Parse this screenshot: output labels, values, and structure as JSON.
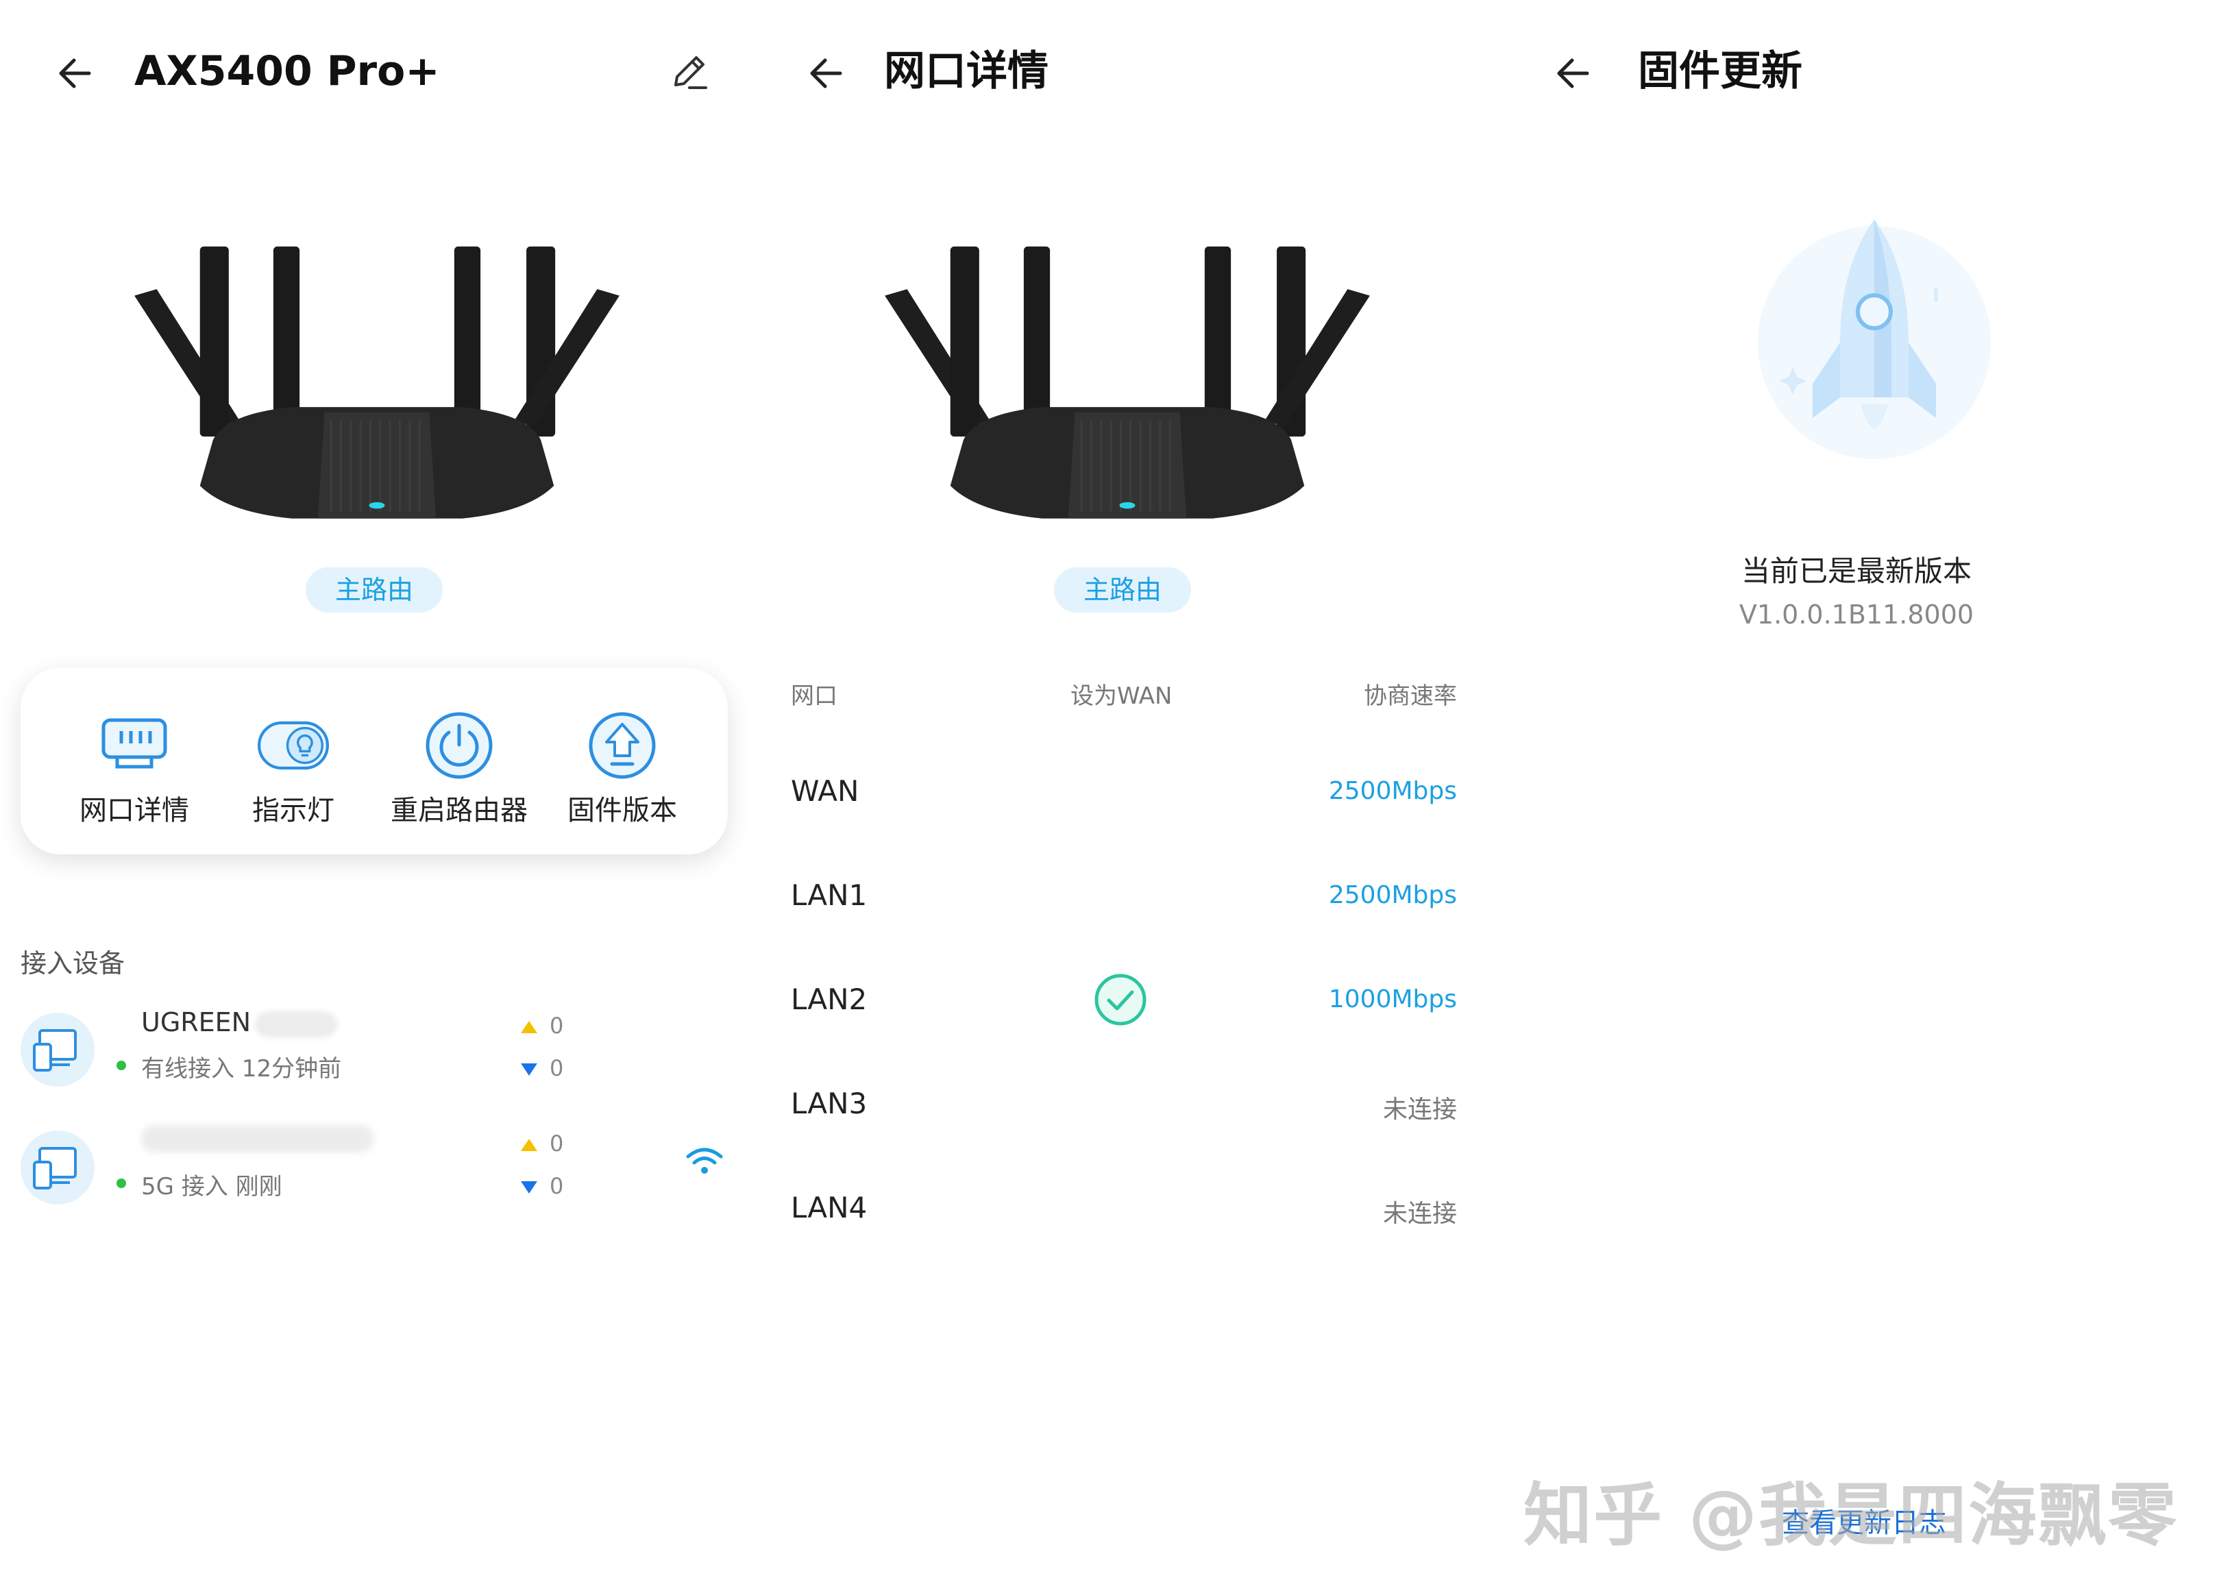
{
  "panel1": {
    "title": "AX5400 Pro+",
    "badge": "主路由",
    "actions": [
      {
        "label": "网口详情",
        "icon": "ethernet-port-icon"
      },
      {
        "label": "指示灯",
        "icon": "indicator-light-icon"
      },
      {
        "label": "重启路由器",
        "icon": "power-icon"
      },
      {
        "label": "固件版本",
        "icon": "firmware-upload-icon"
      }
    ],
    "section_title": "接入设备",
    "devices": [
      {
        "name": "UGREEN",
        "status": "有线接入 12分钟前",
        "up": "0",
        "down": "0"
      },
      {
        "name": "",
        "status": "5G 接入 刚刚",
        "up": "0",
        "down": "0",
        "wifi": true
      }
    ]
  },
  "panel2": {
    "title": "网口详情",
    "badge": "主路由",
    "headers": [
      "网口",
      "设为WAN",
      "协商速率"
    ],
    "rows": [
      {
        "port": "WAN",
        "speed": "2500Mbps",
        "wan": false,
        "connected": true
      },
      {
        "port": "LAN1",
        "speed": "2500Mbps",
        "wan": false,
        "connected": true
      },
      {
        "port": "LAN2",
        "speed": "1000Mbps",
        "wan": true,
        "connected": true
      },
      {
        "port": "LAN3",
        "speed": "未连接",
        "wan": false,
        "connected": false
      },
      {
        "port": "LAN4",
        "speed": "未连接",
        "wan": false,
        "connected": false
      }
    ]
  },
  "panel3": {
    "title": "固件更新",
    "status": "当前已是最新版本",
    "version": "V1.0.0.1B11.8000",
    "link": "查看更新日志"
  },
  "watermark": "知乎 @我是四海飘零",
  "colors": {
    "accent": "#1ba0e2",
    "badge_bg": "#e3f3fd",
    "check": "#2cc5a0",
    "online": "#2fbf45"
  }
}
